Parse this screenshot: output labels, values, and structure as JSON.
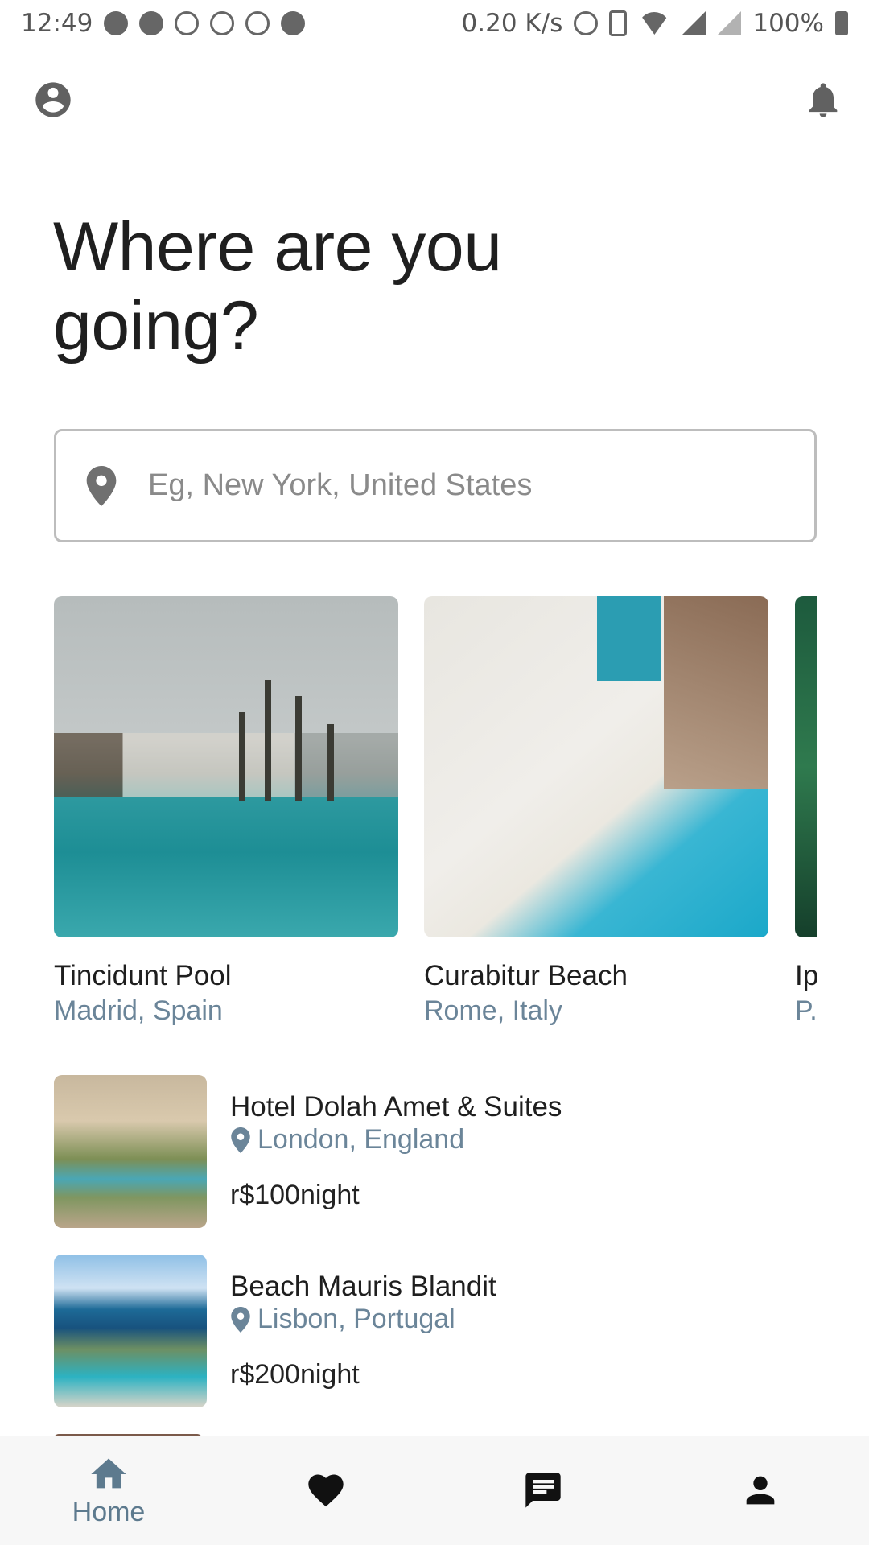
{
  "status_bar": {
    "time": "12:49",
    "net_speed": "0.20 K/s",
    "battery": "100%",
    "left_icons": [
      "facebook-icon",
      "pinterest-icon",
      "download-icon",
      "download-icon",
      "download-icon",
      "reddit-icon"
    ],
    "right_icons": [
      "alarm-icon",
      "vibrate-icon",
      "wifi-icon",
      "signal-icon",
      "no-sim-icon",
      "battery-charging-icon"
    ]
  },
  "header": {
    "profile_icon": "account-circle-icon",
    "notifications_icon": "bell-icon"
  },
  "headline": "Where are you going?",
  "search": {
    "placeholder": "Eg, New York, United States",
    "value": "",
    "icon": "location-pin-icon"
  },
  "featured": [
    {
      "title": "Tincidunt Pool",
      "location": "Madrid, Spain"
    },
    {
      "title": "Curabitur Beach",
      "location": "Rome, Italy"
    },
    {
      "title": "Ip",
      "location": "P."
    }
  ],
  "listings": [
    {
      "name": "Hotel Dolah Amet & Suites",
      "location": "London, England",
      "price": "r$100night"
    },
    {
      "name": "Beach Mauris Blandit",
      "location": "Lisbon, Portugal",
      "price": "r$200night"
    }
  ],
  "bottom_nav": {
    "items": [
      {
        "label": "Home",
        "icon": "home-icon",
        "active": true
      },
      {
        "label": "",
        "icon": "heart-icon",
        "active": false
      },
      {
        "label": "",
        "icon": "message-icon",
        "active": false
      },
      {
        "label": "",
        "icon": "person-icon",
        "active": false
      }
    ]
  },
  "colors": {
    "accent_text": "#6b8599",
    "nav_active": "#5d7a8e",
    "headline": "#1f1f1f"
  }
}
